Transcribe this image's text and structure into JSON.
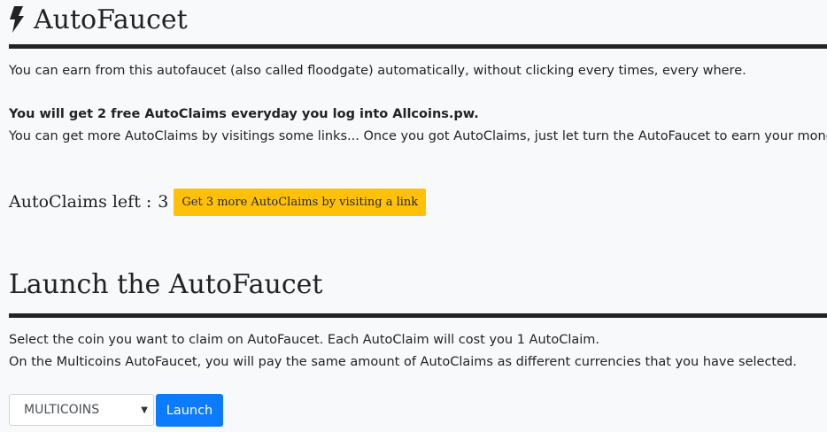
{
  "header": {
    "title": "AutoFaucet",
    "icon": "lightning-bolt-icon"
  },
  "intro": {
    "line1": "You can earn from this autofaucet (also called floodgate) automatically, without clicking every times, every where.",
    "bold_line": "You will get 2 free AutoClaims everyday you log into Allcoins.pw.",
    "line2": "You can get more AutoClaims by visitings some links... Once you got AutoClaims, just let turn the AutoFaucet to earn your money !"
  },
  "claims": {
    "label": "AutoClaims left :",
    "count": "3",
    "button_label": "Get 3 more AutoClaims by visiting a link"
  },
  "launch": {
    "title": "Launch the AutoFaucet",
    "line1": "Select the coin you want to claim on AutoFaucet. Each AutoClaim will cost you 1 AutoClaim.",
    "line2": "On the Multicoins AutoFaucet, you will pay the same amount of AutoClaims as different currencies that you have selected.",
    "select_value": "MULTICOINS",
    "button_label": "Launch"
  },
  "colors": {
    "yellow_button": "#ffc107",
    "blue_button": "#0d7bff",
    "rule": "#232323",
    "background": "#f8f9fb"
  }
}
